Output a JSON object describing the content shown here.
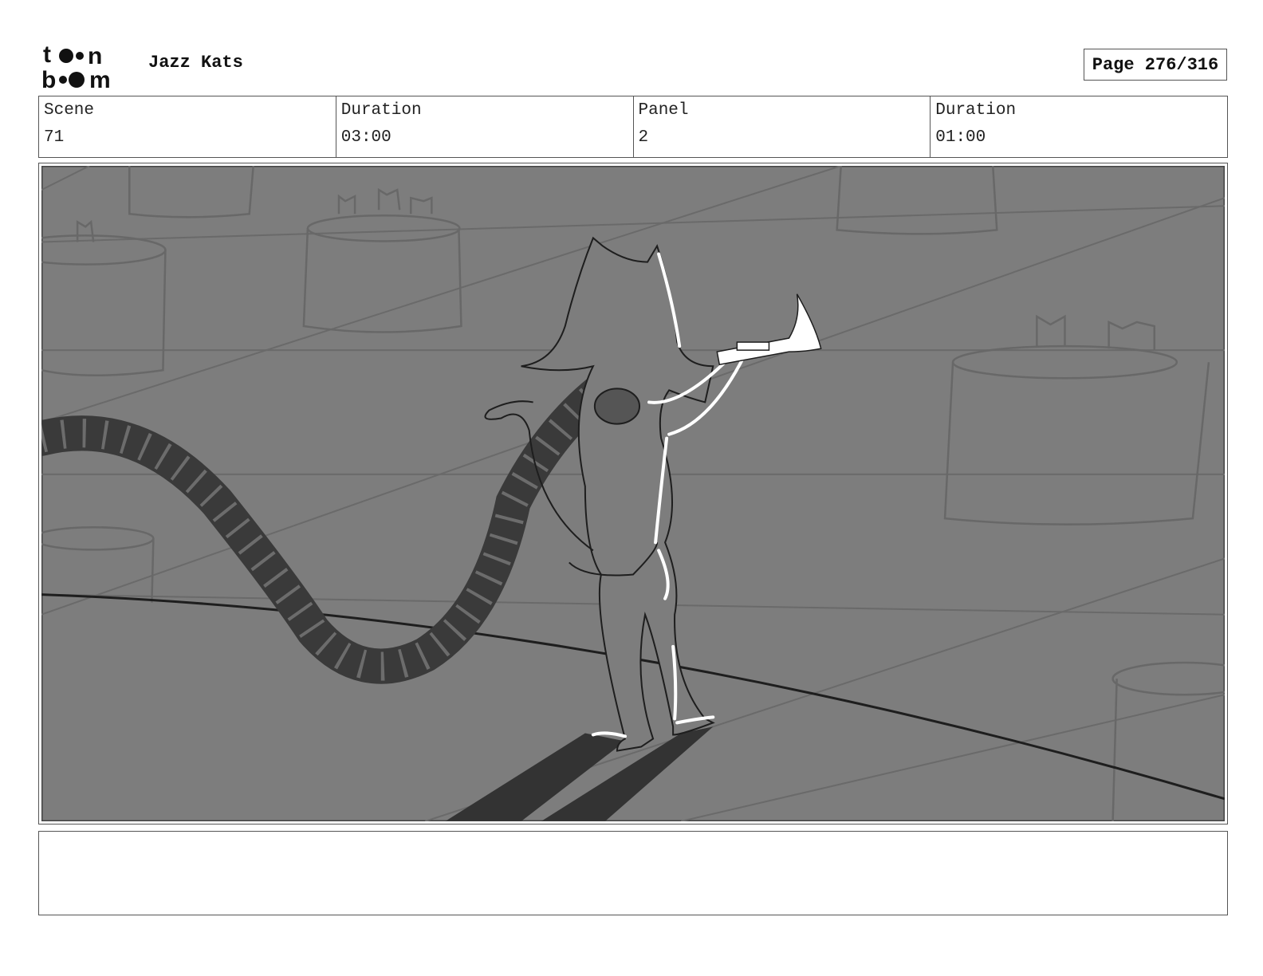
{
  "header": {
    "logo_text_top": "toon",
    "logo_text_bottom": "boom",
    "project_title": "Jazz Kats",
    "page_label": "Page 276/316"
  },
  "info": {
    "scene_label": "Scene",
    "scene_value": "71",
    "scene_duration_label": "Duration",
    "scene_duration_value": "03:00",
    "panel_label": "Panel",
    "panel_value": "2",
    "panel_duration_label": "Duration",
    "panel_duration_value": "01:00"
  },
  "panel": {
    "background_color": "#7d7d7d",
    "shadow_color": "#333333",
    "highlight_color": "#ffffff"
  },
  "notes": {
    "text": ""
  }
}
